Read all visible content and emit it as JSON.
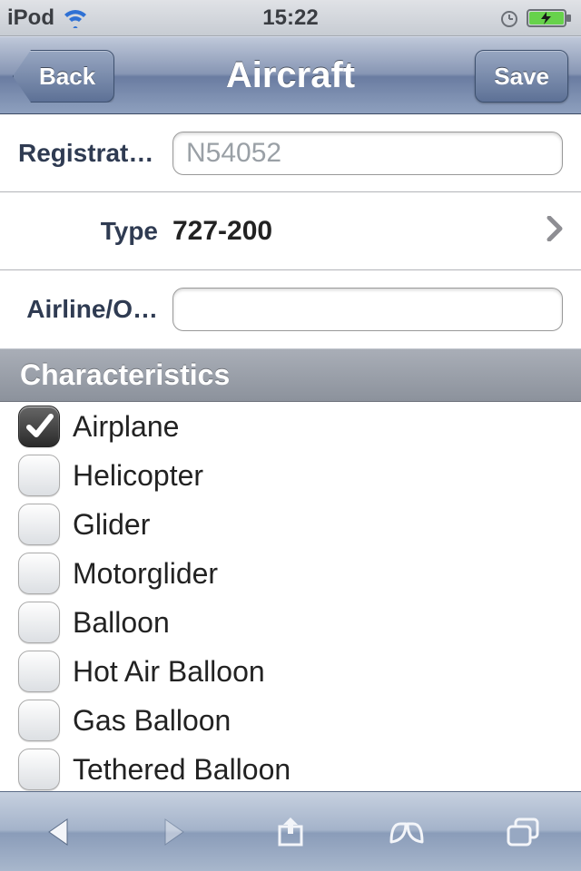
{
  "status_bar": {
    "device": "iPod",
    "time": "15:22"
  },
  "nav": {
    "back_label": "Back",
    "title": "Aircraft",
    "save_label": "Save"
  },
  "form": {
    "registration": {
      "label": "Registrati…",
      "value": "N54052"
    },
    "type": {
      "label": "Type",
      "value": "727-200"
    },
    "airline": {
      "label": "Airline/O…",
      "value": ""
    }
  },
  "section_header": "Characteristics",
  "characteristics": [
    {
      "label": "Airplane",
      "checked": true
    },
    {
      "label": "Helicopter",
      "checked": false
    },
    {
      "label": "Glider",
      "checked": false
    },
    {
      "label": "Motorglider",
      "checked": false
    },
    {
      "label": "Balloon",
      "checked": false
    },
    {
      "label": "Hot Air Balloon",
      "checked": false
    },
    {
      "label": "Gas Balloon",
      "checked": false
    },
    {
      "label": "Tethered Balloon",
      "checked": false
    }
  ]
}
